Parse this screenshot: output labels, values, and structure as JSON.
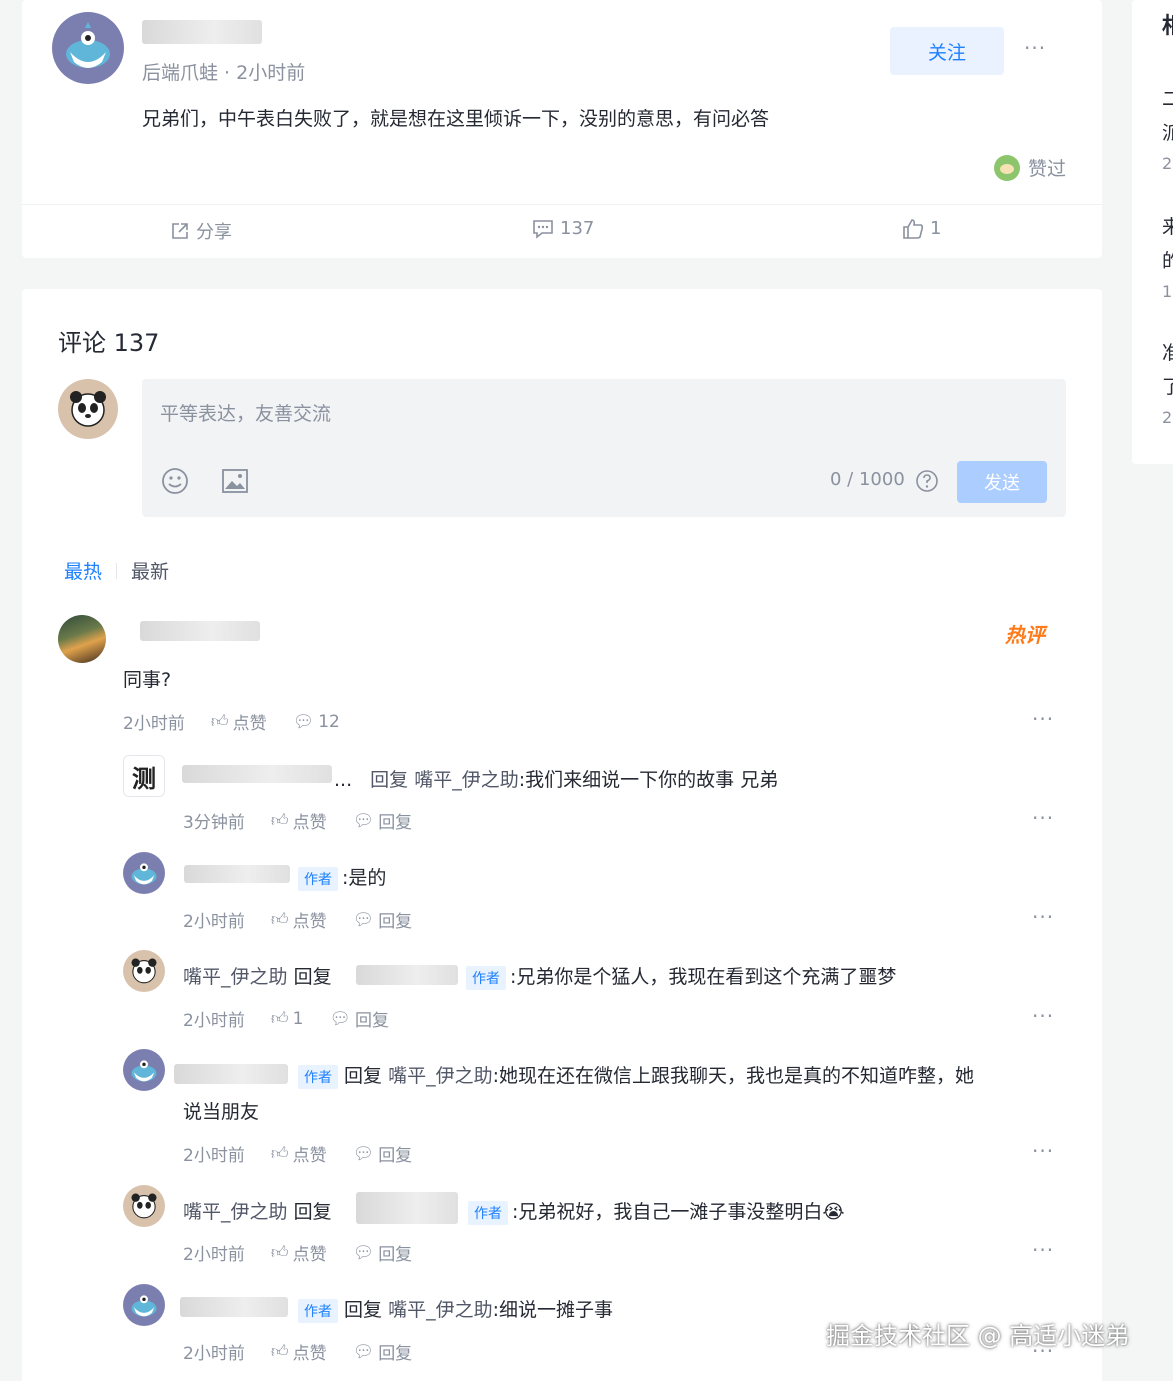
{
  "post": {
    "author_sub": "后端爪蛙 · 2小时前",
    "follow_label": "关注",
    "more_label": "···",
    "content": "兄弟们，中午表白失败了，就是想在这里倾诉一下，没别的意思，有问必答",
    "liked_label": "赞过",
    "actions": {
      "share": "分享",
      "comments": "137",
      "likes": "1"
    }
  },
  "comments_section": {
    "title": "评论 137",
    "input_placeholder": "平等表达，友善交流",
    "counter": "0 / 1000",
    "send_label": "发送",
    "tabs": {
      "hot": "最热",
      "new": "最新"
    },
    "hot_badge": "热评",
    "top_comment": {
      "text": "同事?",
      "time": "2小时前",
      "like_label": "点赞",
      "reply_count": "12"
    },
    "replies": [
      {
        "avatar_glyph": "测",
        "prefix": "...",
        "reply_word": "回复",
        "target": "嘴平_伊之助",
        "text": ":我们来细说一下你的故事 兄弟",
        "time": "3分钟前",
        "like_label": "点赞",
        "reply_label": "回复"
      },
      {
        "author_tag": "作者",
        "text": ":是的",
        "time": "2小时前",
        "like_label": "点赞",
        "reply_label": "回复"
      },
      {
        "name": "嘴平_伊之助",
        "reply_word": "回复",
        "author_tag": "作者",
        "text": ":兄弟你是个猛人，我现在看到这个充满了噩梦",
        "time": "2小时前",
        "like_count": "1",
        "reply_label": "回复"
      },
      {
        "author_tag": "作者",
        "reply_word": "回复",
        "target": "嘴平_伊之助",
        "text": ":她现在还在微信上跟我聊天，我也是真的不知道咋整，她",
        "text_line2": "说当朋友",
        "time": "2小时前",
        "like_label": "点赞",
        "reply_label": "回复"
      },
      {
        "name": "嘴平_伊之助",
        "reply_word": "回复",
        "author_tag": "作者",
        "text": ":兄弟祝好，我自己一滩子事没整明白",
        "emoji": "😭",
        "time": "2小时前",
        "like_label": "点赞",
        "reply_label": "回复"
      },
      {
        "author_tag": "作者",
        "reply_word": "回复",
        "target": "嘴平_伊之助",
        "text": ":细说一摊子事",
        "time": "2小时前",
        "like_label": "点赞",
        "reply_label": "回复"
      }
    ]
  },
  "sidebar": {
    "heading": "相",
    "lines": [
      "二",
      "派",
      "2",
      "来",
      "的",
      "1",
      "准",
      "了",
      "2"
    ]
  },
  "watermark": "掘金技术社区 @ 高适小迷弟",
  "colors": {
    "accent": "#1e80ff",
    "muted": "#8a919f",
    "author_tag_bg": "#e8f3ff",
    "hot": "#ff7a1a"
  }
}
